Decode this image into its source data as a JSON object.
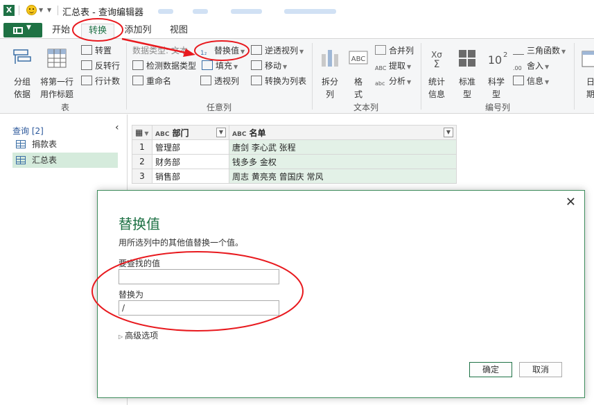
{
  "window": {
    "app_icon": "excel-icon",
    "title": "汇总表 - 查询编辑器"
  },
  "ribbon_tabs": [
    {
      "label": "开始"
    },
    {
      "label": "转换"
    },
    {
      "label": "添加列"
    },
    {
      "label": "视图"
    }
  ],
  "ribbon": {
    "table_group": {
      "label": "表",
      "group_by": "分组\n依据",
      "use_first_row": "将第一行\n用作标题",
      "transpose": "转置",
      "reverse_rows": "反转行",
      "count_rows": "行计数"
    },
    "any_column_group": {
      "label": "任意列",
      "data_type_prefix": "数据类型: 文本",
      "replace_values": "替换值",
      "unpivot": "逆透视列",
      "detect_type": "检测数据类型",
      "fill": "填充",
      "move": "移动",
      "rename": "重命名",
      "pivot": "透视列",
      "convert_to_list": "转换为列表"
    },
    "text_column_group": {
      "label": "文本列",
      "split": "拆分\n列",
      "format": "格\n式",
      "merge": "合并列",
      "extract": "提取",
      "parse": "分析"
    },
    "number_column_group": {
      "label": "编号列",
      "statistics": "统计\n信息",
      "standard": "标准\n型",
      "scientific": "科学\n型",
      "trig": "三角函数",
      "rounding": "舍入",
      "info": "信息",
      "date_partial": "日\n期"
    }
  },
  "queries": {
    "header": "查询 [2]",
    "items": [
      {
        "label": "捐款表"
      },
      {
        "label": "汇总表"
      }
    ]
  },
  "grid": {
    "columns": [
      {
        "type": "ABC",
        "label": "部门"
      },
      {
        "type": "ABC",
        "label": "名单"
      }
    ],
    "rows": [
      {
        "n": "1",
        "dept": "管理部",
        "names": "唐剑 李心武 张程"
      },
      {
        "n": "2",
        "dept": "财务部",
        "names": "钱多多 金权"
      },
      {
        "n": "3",
        "dept": "销售部",
        "names": "周志 黄亮亮 曾国庆 常风"
      }
    ]
  },
  "dialog": {
    "title": "替换值",
    "description": "用所选列中的其他值替换一个值。",
    "find_label": "要查找的值",
    "find_value": "",
    "replace_label": "替换为",
    "replace_value": "/",
    "advanced": "高级选项",
    "ok": "确定",
    "cancel": "取消"
  },
  "colors": {
    "accent": "#1e7145",
    "annotation": "#e8191e",
    "selection": "#d5ebdc"
  }
}
